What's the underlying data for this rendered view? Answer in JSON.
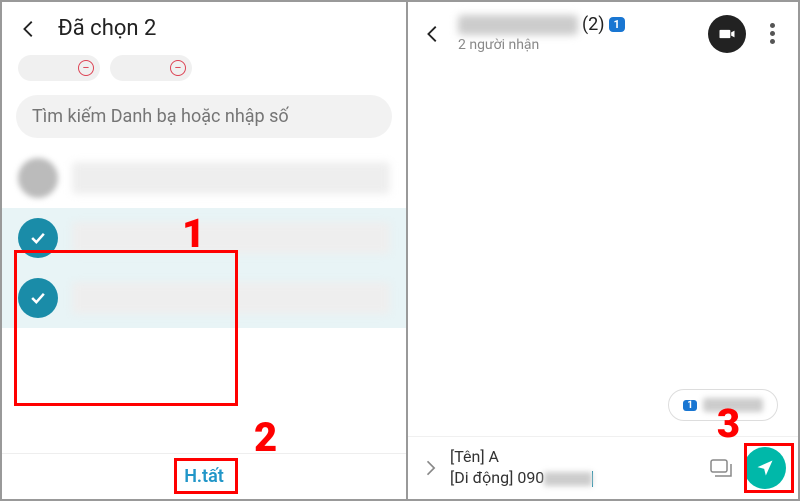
{
  "left": {
    "title": "Đã chọn 2",
    "search_placeholder": "Tìm kiếm Danh bạ hoặc nhập số",
    "done_label": "H.tất"
  },
  "right": {
    "header_count": "(2)",
    "header_badge": "1",
    "header_sub": "2 người nhận",
    "bubble_badge": "1",
    "compose_line1": "[Tên] A",
    "compose_line2_prefix": "[Di động] 090"
  },
  "annotations": {
    "n1": "1",
    "n2": "2",
    "n3": "3"
  }
}
